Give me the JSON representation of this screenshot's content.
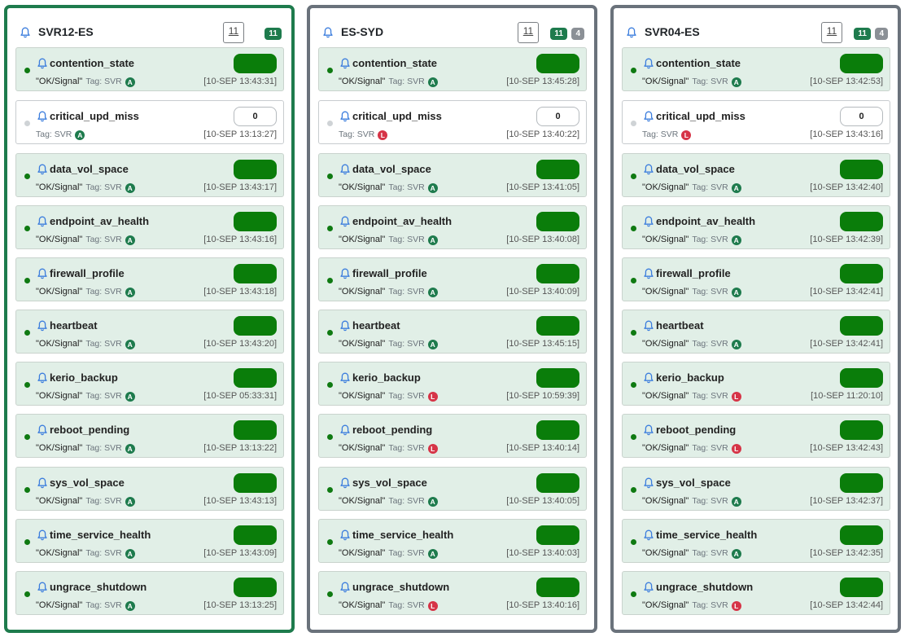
{
  "colors": {
    "ok_border": "#1e7b4d",
    "warn_border": "#6a727b",
    "card_ok_bg": "#e1efe7",
    "value_green": "#0a7d0a",
    "status_dot_green": "#0f7a12",
    "status_dot_grey": "#cfd3d6",
    "badge_auto": "#1e7b4d",
    "badge_late": "#d63447",
    "bell_blue": "#3b7ddd"
  },
  "panels": [
    {
      "title": "SVR12-ES",
      "status": "ok",
      "count_label": "11",
      "ok_count": "11",
      "other_count": "",
      "checks": [
        {
          "name": "contention_state",
          "value": "",
          "zero": false,
          "signal": "\"OK/Signal\"",
          "tag": "Tag: SVR",
          "badge": "A",
          "ts": "[10-SEP 13:43:31]"
        },
        {
          "name": "critical_upd_miss",
          "value": "0",
          "zero": true,
          "signal": "",
          "tag": "Tag: SVR",
          "badge": "A",
          "ts": "[10-SEP 13:13:27]"
        },
        {
          "name": "data_vol_space",
          "value": "",
          "zero": false,
          "signal": "\"OK/Signal\"",
          "tag": "Tag: SVR",
          "badge": "A",
          "ts": "[10-SEP 13:43:17]"
        },
        {
          "name": "endpoint_av_health",
          "value": "",
          "zero": false,
          "signal": "\"OK/Signal\"",
          "tag": "Tag: SVR",
          "badge": "A",
          "ts": "[10-SEP 13:43:16]"
        },
        {
          "name": "firewall_profile",
          "value": "",
          "zero": false,
          "signal": "\"OK/Signal\"",
          "tag": "Tag: SVR",
          "badge": "A",
          "ts": "[10-SEP 13:43:18]"
        },
        {
          "name": "heartbeat",
          "value": "",
          "zero": false,
          "signal": "\"OK/Signal\"",
          "tag": "Tag: SVR",
          "badge": "A",
          "ts": "[10-SEP 13:43:20]"
        },
        {
          "name": "kerio_backup",
          "value": "",
          "zero": false,
          "signal": "\"OK/Signal\"",
          "tag": "Tag: SVR",
          "badge": "A",
          "ts": "[10-SEP 05:33:31]"
        },
        {
          "name": "reboot_pending",
          "value": "",
          "zero": false,
          "signal": "\"OK/Signal\"",
          "tag": "Tag: SVR",
          "badge": "A",
          "ts": "[10-SEP 13:13:22]"
        },
        {
          "name": "sys_vol_space",
          "value": "",
          "zero": false,
          "signal": "\"OK/Signal\"",
          "tag": "Tag: SVR",
          "badge": "A",
          "ts": "[10-SEP 13:43:13]"
        },
        {
          "name": "time_service_health",
          "value": "",
          "zero": false,
          "signal": "\"OK/Signal\"",
          "tag": "Tag: SVR",
          "badge": "A",
          "ts": "[10-SEP 13:43:09]"
        },
        {
          "name": "ungrace_shutdown",
          "value": "",
          "zero": false,
          "signal": "\"OK/Signal\"",
          "tag": "Tag: SVR",
          "badge": "A",
          "ts": "[10-SEP 13:13:25]"
        }
      ]
    },
    {
      "title": "ES-SYD",
      "status": "warn",
      "count_label": "11",
      "ok_count": "11",
      "other_count": "4",
      "checks": [
        {
          "name": "contention_state",
          "value": "",
          "zero": false,
          "signal": "\"OK/Signal\"",
          "tag": "Tag: SVR",
          "badge": "A",
          "ts": "[10-SEP 13:45:28]"
        },
        {
          "name": "critical_upd_miss",
          "value": "0",
          "zero": true,
          "signal": "",
          "tag": "Tag: SVR",
          "badge": "L",
          "ts": "[10-SEP 13:40:22]"
        },
        {
          "name": "data_vol_space",
          "value": "",
          "zero": false,
          "signal": "\"OK/Signal\"",
          "tag": "Tag: SVR",
          "badge": "A",
          "ts": "[10-SEP 13:41:05]"
        },
        {
          "name": "endpoint_av_health",
          "value": "",
          "zero": false,
          "signal": "\"OK/Signal\"",
          "tag": "Tag: SVR",
          "badge": "A",
          "ts": "[10-SEP 13:40:08]"
        },
        {
          "name": "firewall_profile",
          "value": "",
          "zero": false,
          "signal": "\"OK/Signal\"",
          "tag": "Tag: SVR",
          "badge": "A",
          "ts": "[10-SEP 13:40:09]"
        },
        {
          "name": "heartbeat",
          "value": "",
          "zero": false,
          "signal": "\"OK/Signal\"",
          "tag": "Tag: SVR",
          "badge": "A",
          "ts": "[10-SEP 13:45:15]"
        },
        {
          "name": "kerio_backup",
          "value": "",
          "zero": false,
          "signal": "\"OK/Signal\"",
          "tag": "Tag: SVR",
          "badge": "L",
          "ts": "[10-SEP 10:59:39]"
        },
        {
          "name": "reboot_pending",
          "value": "",
          "zero": false,
          "signal": "\"OK/Signal\"",
          "tag": "Tag: SVR",
          "badge": "L",
          "ts": "[10-SEP 13:40:14]"
        },
        {
          "name": "sys_vol_space",
          "value": "",
          "zero": false,
          "signal": "\"OK/Signal\"",
          "tag": "Tag: SVR",
          "badge": "A",
          "ts": "[10-SEP 13:40:05]"
        },
        {
          "name": "time_service_health",
          "value": "",
          "zero": false,
          "signal": "\"OK/Signal\"",
          "tag": "Tag: SVR",
          "badge": "A",
          "ts": "[10-SEP 13:40:03]"
        },
        {
          "name": "ungrace_shutdown",
          "value": "",
          "zero": false,
          "signal": "\"OK/Signal\"",
          "tag": "Tag: SVR",
          "badge": "L",
          "ts": "[10-SEP 13:40:16]"
        }
      ]
    },
    {
      "title": "SVR04-ES",
      "status": "warn",
      "count_label": "11",
      "ok_count": "11",
      "other_count": "4",
      "checks": [
        {
          "name": "contention_state",
          "value": "",
          "zero": false,
          "signal": "\"OK/Signal\"",
          "tag": "Tag: SVR",
          "badge": "A",
          "ts": "[10-SEP 13:42:53]"
        },
        {
          "name": "critical_upd_miss",
          "value": "0",
          "zero": true,
          "signal": "",
          "tag": "Tag: SVR",
          "badge": "L",
          "ts": "[10-SEP 13:43:16]"
        },
        {
          "name": "data_vol_space",
          "value": "",
          "zero": false,
          "signal": "\"OK/Signal\"",
          "tag": "Tag: SVR",
          "badge": "A",
          "ts": "[10-SEP 13:42:40]"
        },
        {
          "name": "endpoint_av_health",
          "value": "",
          "zero": false,
          "signal": "\"OK/Signal\"",
          "tag": "Tag: SVR",
          "badge": "A",
          "ts": "[10-SEP 13:42:39]"
        },
        {
          "name": "firewall_profile",
          "value": "",
          "zero": false,
          "signal": "\"OK/Signal\"",
          "tag": "Tag: SVR",
          "badge": "A",
          "ts": "[10-SEP 13:42:41]"
        },
        {
          "name": "heartbeat",
          "value": "",
          "zero": false,
          "signal": "\"OK/Signal\"",
          "tag": "Tag: SVR",
          "badge": "A",
          "ts": "[10-SEP 13:42:41]"
        },
        {
          "name": "kerio_backup",
          "value": "",
          "zero": false,
          "signal": "\"OK/Signal\"",
          "tag": "Tag: SVR",
          "badge": "L",
          "ts": "[10-SEP 11:20:10]"
        },
        {
          "name": "reboot_pending",
          "value": "",
          "zero": false,
          "signal": "\"OK/Signal\"",
          "tag": "Tag: SVR",
          "badge": "L",
          "ts": "[10-SEP 13:42:43]"
        },
        {
          "name": "sys_vol_space",
          "value": "",
          "zero": false,
          "signal": "\"OK/Signal\"",
          "tag": "Tag: SVR",
          "badge": "A",
          "ts": "[10-SEP 13:42:37]"
        },
        {
          "name": "time_service_health",
          "value": "",
          "zero": false,
          "signal": "\"OK/Signal\"",
          "tag": "Tag: SVR",
          "badge": "A",
          "ts": "[10-SEP 13:42:35]"
        },
        {
          "name": "ungrace_shutdown",
          "value": "",
          "zero": false,
          "signal": "\"OK/Signal\"",
          "tag": "Tag: SVR",
          "badge": "L",
          "ts": "[10-SEP 13:42:44]"
        }
      ]
    }
  ]
}
